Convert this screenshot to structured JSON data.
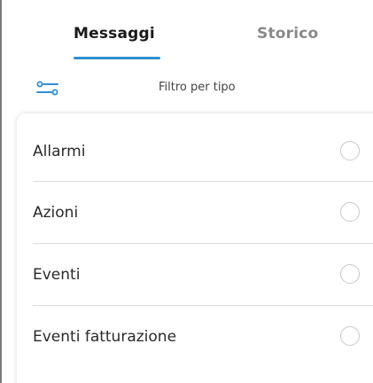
{
  "tabs": [
    {
      "label": "Messaggi",
      "active": true
    },
    {
      "label": "Storico",
      "active": false
    }
  ],
  "filter": {
    "icon": "filter-sliders-icon",
    "label": "Filtro per tipo"
  },
  "types": [
    {
      "label": "Allarmi",
      "selected": false
    },
    {
      "label": "Azioni",
      "selected": false
    },
    {
      "label": "Eventi",
      "selected": false
    },
    {
      "label": "Eventi fatturazione",
      "selected": false
    }
  ],
  "colors": {
    "accent": "#2f8fd0",
    "text": "#2a2a2a",
    "inactive_tab": "#8a8a8a",
    "divider": "#dddddd"
  }
}
